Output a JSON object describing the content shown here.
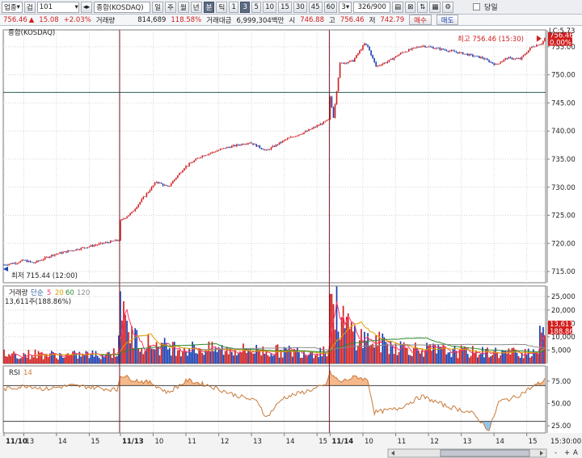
{
  "toolbar": {
    "market_select": "업종",
    "search_label": "검",
    "code_value": "101",
    "name_value": "종합(KOSDAQ)",
    "periods": [
      "일",
      "주",
      "월",
      "년",
      "분",
      "틱"
    ],
    "active_period": "분",
    "minute_options": [
      "1",
      "3",
      "5",
      "10",
      "15",
      "30",
      "45",
      "60"
    ],
    "active_minute": "3",
    "custom_minute": "3",
    "count_value": "326/900",
    "today_label": "당일"
  },
  "info": {
    "price": "756.46",
    "change_arrow": "▲",
    "change": "15.08",
    "change_pct": "+2.03%",
    "volume_label": "거래량",
    "volume": "814,689",
    "volume_pct": "118.58%",
    "amount_label": "거래대금",
    "amount": "6,999,304백만",
    "open_label": "시",
    "open": "746.88",
    "high_label": "고",
    "high": "756.46",
    "low_label": "저",
    "low": "742.79",
    "buy_label": "매수",
    "sell_label": "매도"
  },
  "colors": {
    "up": "#d11e1e",
    "down": "#1a3fb0",
    "rsi_line": "#c87a3a",
    "rsi_fill_high": "#f5b98c",
    "rsi_fill_low": "#8fc8ee",
    "ma5": "#ff3366",
    "ma20": "#d9a300",
    "ma60": "#2f8a2f",
    "ma120": "#8a8a8a",
    "hline": "#2a5e56",
    "vline": "#7a1f2a"
  },
  "chart_data": [
    {
      "type": "candlestick",
      "title": "종합(KOSDAQ)",
      "ylim": [
        713,
        758
      ],
      "yticks": [
        715,
        720,
        725,
        730,
        735,
        740,
        745,
        750,
        755
      ],
      "right_top_label": "LC:5.73",
      "last_price_label": "756.46",
      "last_pct_label": "0.00%",
      "high_annotation": "최고 756.46 (15:30)",
      "low_annotation": "최저 715.44 (12:00)",
      "anchors": [
        [
          0,
          716.2
        ],
        [
          8,
          716.6
        ],
        [
          12,
          717.0
        ],
        [
          18,
          716.5
        ],
        [
          30,
          718.0
        ],
        [
          45,
          719.0
        ],
        [
          60,
          720.0
        ],
        [
          70,
          720.6
        ],
        [
          71,
          724.0
        ],
        [
          78,
          725.5
        ],
        [
          86,
          728.5
        ],
        [
          93,
          731.0
        ],
        [
          100,
          730.0
        ],
        [
          110,
          733.5
        ],
        [
          120,
          735.5
        ],
        [
          135,
          737.0
        ],
        [
          150,
          738.0
        ],
        [
          160,
          736.5
        ],
        [
          172,
          738.5
        ],
        [
          185,
          740.0
        ],
        [
          195,
          741.5
        ],
        [
          198,
          742.0
        ],
        [
          199,
          746.0
        ],
        [
          201,
          742.5
        ],
        [
          205,
          752.0
        ],
        [
          213,
          752.5
        ],
        [
          220,
          755.5
        ],
        [
          222,
          755.0
        ],
        [
          227,
          751.5
        ],
        [
          235,
          752.5
        ],
        [
          243,
          754.0
        ],
        [
          255,
          755.2
        ],
        [
          268,
          754.5
        ],
        [
          280,
          753.8
        ],
        [
          292,
          753.0
        ],
        [
          300,
          751.8
        ],
        [
          307,
          753.0
        ],
        [
          315,
          752.8
        ],
        [
          322,
          755.0
        ],
        [
          328,
          755.6
        ],
        [
          330,
          756.46
        ]
      ],
      "hline": 746.88
    },
    {
      "type": "bar",
      "title": "거래량",
      "legend": [
        "단순",
        "5",
        "20",
        "60",
        "120"
      ],
      "subtitle": "13,611주(188.86%)",
      "ylim": [
        0,
        29000
      ],
      "yticks": [
        5000,
        10000,
        15000,
        20000,
        25000
      ],
      "last_value_label": "13,611",
      "last_pct_label": "188.86%",
      "anchors": [
        [
          0,
          3800
        ],
        [
          10,
          3300
        ],
        [
          20,
          3600
        ],
        [
          30,
          3200
        ],
        [
          40,
          3000
        ],
        [
          50,
          3400
        ],
        [
          60,
          3300
        ],
        [
          69,
          4200
        ],
        [
          71,
          27000
        ],
        [
          73,
          15500
        ],
        [
          76,
          12000
        ],
        [
          80,
          9500
        ],
        [
          86,
          7500
        ],
        [
          95,
          6500
        ],
        [
          110,
          5800
        ],
        [
          130,
          5200
        ],
        [
          150,
          5000
        ],
        [
          170,
          4600
        ],
        [
          190,
          4400
        ],
        [
          198,
          5200
        ],
        [
          199,
          26000
        ],
        [
          202,
          20000
        ],
        [
          206,
          16000
        ],
        [
          212,
          12000
        ],
        [
          220,
          9000
        ],
        [
          235,
          7000
        ],
        [
          250,
          5600
        ],
        [
          270,
          4600
        ],
        [
          290,
          4200
        ],
        [
          310,
          4000
        ],
        [
          325,
          4800
        ],
        [
          329,
          13611
        ]
      ]
    },
    {
      "type": "line",
      "title": "RSI",
      "legend": [
        "14"
      ],
      "ylim": [
        17,
        92
      ],
      "yticks": [
        25,
        50,
        75
      ],
      "hline_upper": 70,
      "hline_lower": 30,
      "anchors": [
        [
          0,
          66
        ],
        [
          15,
          70
        ],
        [
          25,
          66
        ],
        [
          40,
          70
        ],
        [
          55,
          68
        ],
        [
          69,
          65
        ],
        [
          71,
          82
        ],
        [
          80,
          76
        ],
        [
          90,
          73
        ],
        [
          100,
          62
        ],
        [
          112,
          76
        ],
        [
          125,
          70
        ],
        [
          140,
          60
        ],
        [
          155,
          52
        ],
        [
          160,
          34
        ],
        [
          170,
          56
        ],
        [
          185,
          64
        ],
        [
          196,
          70
        ],
        [
          199,
          84
        ],
        [
          205,
          74
        ],
        [
          215,
          80
        ],
        [
          222,
          76
        ],
        [
          226,
          40
        ],
        [
          240,
          44
        ],
        [
          255,
          58
        ],
        [
          270,
          47
        ],
        [
          285,
          40
        ],
        [
          292,
          28
        ],
        [
          296,
          20
        ],
        [
          302,
          52
        ],
        [
          312,
          57
        ],
        [
          322,
          68
        ],
        [
          330,
          76
        ]
      ]
    }
  ],
  "xaxis": {
    "ticks": [
      {
        "idx": 0,
        "label": "11/10",
        "bold": true
      },
      {
        "idx": 12,
        "label": "13",
        "bold": false
      },
      {
        "idx": 32,
        "label": "14",
        "bold": false
      },
      {
        "idx": 52,
        "label": "15",
        "bold": false
      },
      {
        "idx": 71,
        "label": "11/13",
        "bold": true
      },
      {
        "idx": 91,
        "label": "10",
        "bold": false
      },
      {
        "idx": 111,
        "label": "11",
        "bold": false
      },
      {
        "idx": 131,
        "label": "12",
        "bold": false
      },
      {
        "idx": 151,
        "label": "13",
        "bold": false
      },
      {
        "idx": 171,
        "label": "14",
        "bold": false
      },
      {
        "idx": 191,
        "label": "15",
        "bold": false
      },
      {
        "idx": 199,
        "label": "11/14",
        "bold": true
      },
      {
        "idx": 219,
        "label": "10",
        "bold": false
      },
      {
        "idx": 239,
        "label": "11",
        "bold": false
      },
      {
        "idx": 259,
        "label": "12",
        "bold": false
      },
      {
        "idx": 279,
        "label": "13",
        "bold": false
      },
      {
        "idx": 299,
        "label": "14",
        "bold": false
      },
      {
        "idx": 319,
        "label": "15",
        "bold": false
      }
    ],
    "right_label": "15:30:00",
    "session_breaks": [
      71,
      199
    ],
    "zoom_controls": [
      "-",
      "+",
      "A"
    ]
  }
}
